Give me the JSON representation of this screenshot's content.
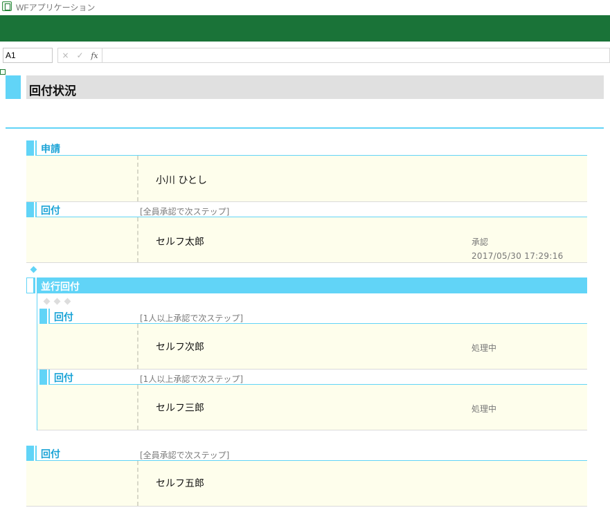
{
  "window": {
    "title": "WFアプリケーション"
  },
  "formula_bar": {
    "cell_ref": "A1",
    "cancel_icon": "×",
    "enter_icon": "✓",
    "fx_label": "fx"
  },
  "page": {
    "title": "回付状況"
  },
  "application": {
    "label": "申請",
    "applicant": "小川 ひとし"
  },
  "route1": {
    "label": "回付",
    "condition": "[全員承認で次ステップ]",
    "approver": "セルフ太郎",
    "status": "承認",
    "timestamp": "2017/05/30 17:29:16"
  },
  "parallel": {
    "label": "並行回付",
    "branches": [
      {
        "label": "回付",
        "condition": "[1人以上承認で次ステップ]",
        "approver": "セルフ次郎",
        "status": "処理中"
      },
      {
        "label": "回付",
        "condition": "[1人以上承認で次ステップ]",
        "approver": "セルフ三郎",
        "status": "処理中"
      }
    ]
  },
  "route3": {
    "label": "回付",
    "condition": "[全員承認で次ステップ]",
    "approver": "セルフ五郎"
  },
  "colors": {
    "ribbon": "#1a7338",
    "accent": "#61d4f7",
    "label": "#1aa3d6",
    "row_bg": "#fefeec"
  }
}
